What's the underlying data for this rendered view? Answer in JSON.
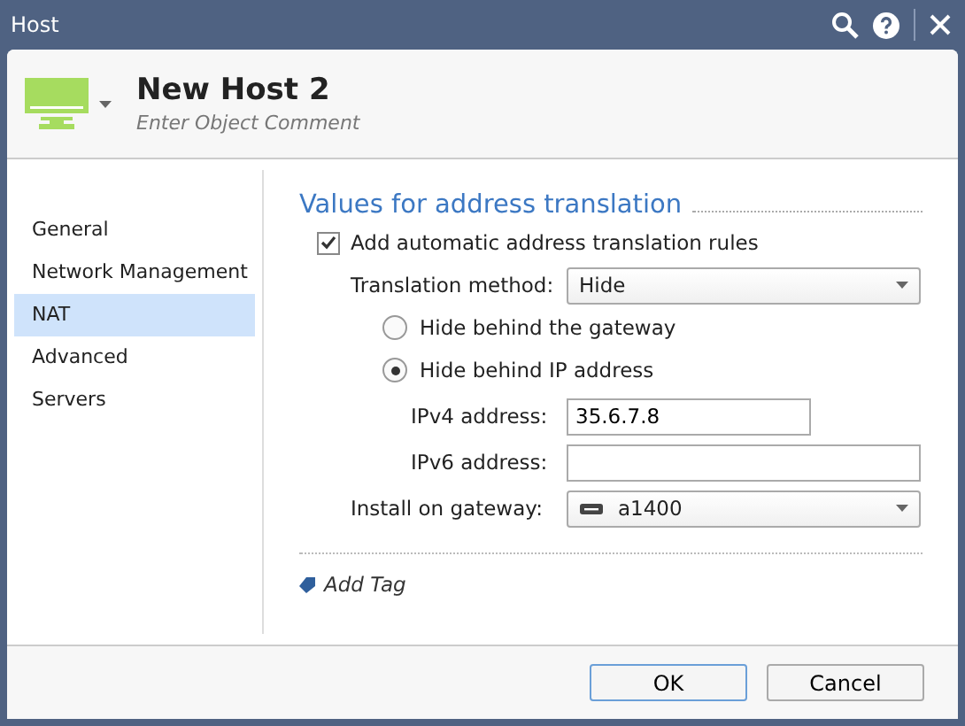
{
  "window": {
    "title": "Host"
  },
  "header": {
    "name": "New Host 2",
    "comment_placeholder": "Enter Object Comment"
  },
  "sidebar": {
    "items": [
      {
        "label": "General",
        "selected": false
      },
      {
        "label": "Network Management",
        "selected": false
      },
      {
        "label": "NAT",
        "selected": true
      },
      {
        "label": "Advanced",
        "selected": false
      },
      {
        "label": "Servers",
        "selected": false
      }
    ]
  },
  "section": {
    "title": "Values for address translation",
    "auto_rules": {
      "label": "Add automatic address translation rules",
      "checked": true
    },
    "method": {
      "label": "Translation method:",
      "value": "Hide"
    },
    "options": [
      {
        "label": "Hide behind the gateway",
        "selected": false
      },
      {
        "label": "Hide behind IP address",
        "selected": true
      }
    ],
    "ipv4": {
      "label": "IPv4 address:",
      "value": "35.6.7.8"
    },
    "ipv6": {
      "label": "IPv6 address:"
    },
    "gateway": {
      "label": "Install on gateway:",
      "value": "a1400"
    }
  },
  "add_tag": "Add Tag",
  "buttons": [
    "OK",
    "Cancel"
  ]
}
